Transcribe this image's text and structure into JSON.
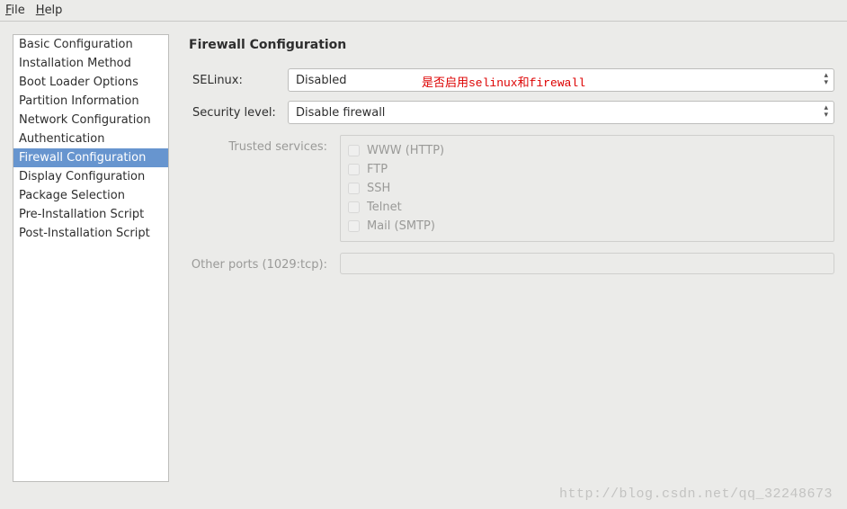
{
  "menubar": {
    "file": "File",
    "help": "Help"
  },
  "sidebar": {
    "items": [
      {
        "label": "Basic Configuration"
      },
      {
        "label": "Installation Method"
      },
      {
        "label": "Boot Loader Options"
      },
      {
        "label": "Partition Information"
      },
      {
        "label": "Network Configuration"
      },
      {
        "label": "Authentication"
      },
      {
        "label": "Firewall Configuration"
      },
      {
        "label": "Display Configuration"
      },
      {
        "label": "Package Selection"
      },
      {
        "label": "Pre-Installation Script"
      },
      {
        "label": "Post-Installation Script"
      }
    ],
    "selected_index": 6
  },
  "main": {
    "title": "Firewall Configuration",
    "selinux": {
      "label": "SELinux:",
      "value": "Disabled"
    },
    "security": {
      "label": "Security level:",
      "value": "Disable firewall"
    },
    "annotation": "是否启用selinux和firewall",
    "trusted": {
      "label": "Trusted services:",
      "items": [
        {
          "label": "WWW (HTTP)"
        },
        {
          "label": "FTP"
        },
        {
          "label": "SSH"
        },
        {
          "label": "Telnet"
        },
        {
          "label": "Mail (SMTP)"
        }
      ]
    },
    "other_ports": {
      "label": "Other ports (1029:tcp):",
      "value": ""
    }
  },
  "watermark": "http://blog.csdn.net/qq_32248673"
}
